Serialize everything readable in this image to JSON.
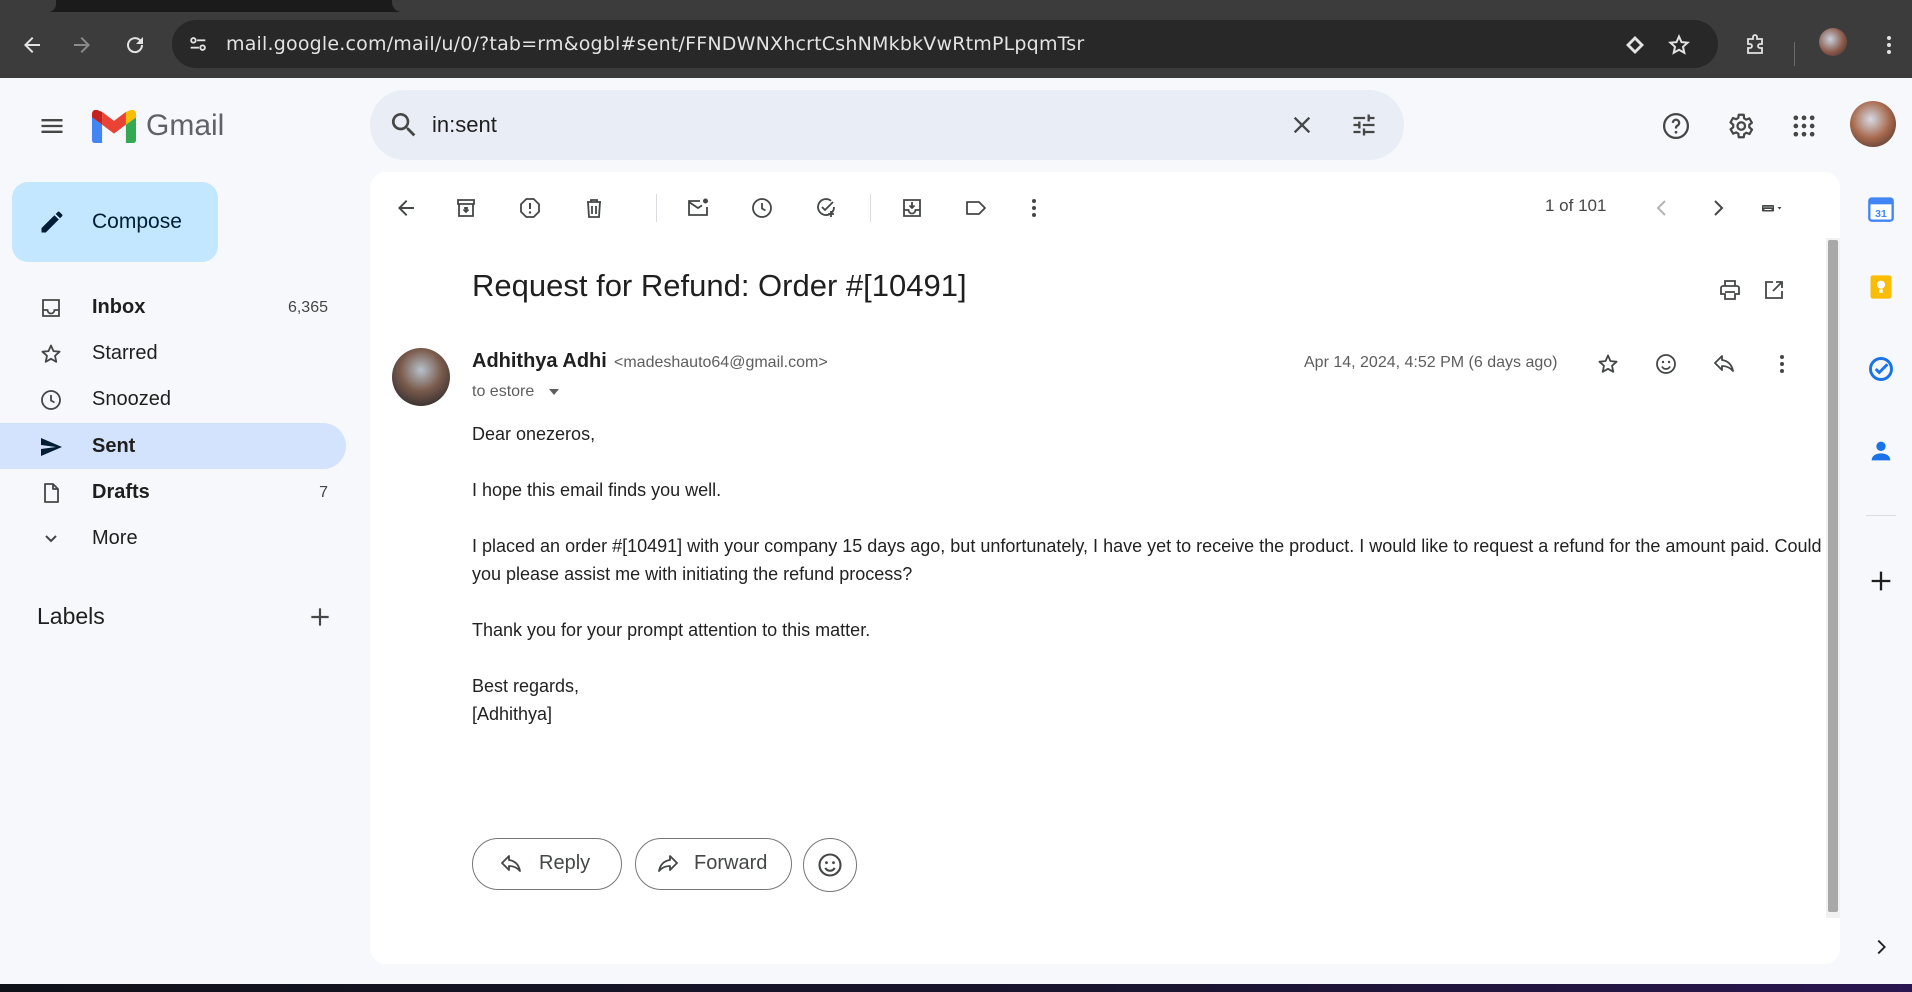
{
  "browser": {
    "url": "mail.google.com/mail/u/0/?tab=rm&ogbl#sent/FFNDWNXhcrtCshNMkbkVwRtmPLpqmTsr"
  },
  "app": {
    "name": "Gmail"
  },
  "search": {
    "query": "in:sent"
  },
  "sidebar": {
    "compose_label": "Compose",
    "items": [
      {
        "label": "Inbox",
        "count": "6,365"
      },
      {
        "label": "Starred",
        "count": ""
      },
      {
        "label": "Snoozed",
        "count": ""
      },
      {
        "label": "Sent",
        "count": ""
      },
      {
        "label": "Drafts",
        "count": "7"
      },
      {
        "label": "More",
        "count": ""
      }
    ],
    "labels_title": "Labels"
  },
  "toolbar": {
    "pager": "1 of 101"
  },
  "email": {
    "subject": "Request for Refund: Order #[10491]",
    "sender_name": "Adhithya Adhi",
    "sender_email": "<madeshauto64@gmail.com>",
    "to_line": "to estore",
    "date": "Apr 14, 2024, 4:52 PM (6 days ago)",
    "body": [
      "Dear onezeros,",
      "I hope this email finds you well.",
      "I placed an order #[10491] with your company 15 days ago, but unfortunately, I have yet to receive the product. I would like to request a refund for the amount paid. Could you please assist me with initiating the refund process?",
      "Thank you for your prompt attention to this matter.",
      "Best regards,",
      "[Adhithya]"
    ]
  },
  "actions": {
    "reply_label": "Reply",
    "forward_label": "Forward"
  },
  "colors": {
    "accent": "#0b57d0",
    "compose_bg": "#c2e7ff",
    "active_nav": "#d3e3fd",
    "page_bg": "#f6f8fc"
  }
}
